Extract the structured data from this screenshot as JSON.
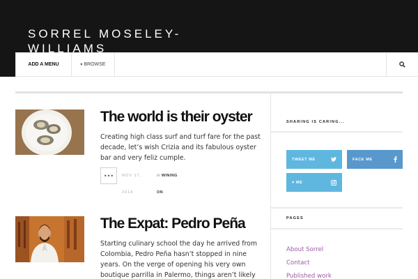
{
  "header": {
    "site_title": "SORREL MOSELEY-WILLIAMS"
  },
  "nav": {
    "add_menu": "ADD A MENU",
    "browse": "BROWSE",
    "search_icon": "search-icon"
  },
  "posts": [
    {
      "title": "The world is their oyster",
      "excerpt": "Creating high class surf and turf fare for the past decade, let’s wish Crizia and its fabulous oyster bar and very feliz cumple.",
      "date_line1": "NOV 17,",
      "date_line2": "2014",
      "meta_in": "In",
      "category_line1": "WINING",
      "category_line2": "ON",
      "more_label": "•••"
    },
    {
      "title": "The Expat: Pedro Peña",
      "excerpt": "Starting culinary school the day he arrived from Colombia, Pedro Peña hasn’t stopped in nine years. On the verge of opening his very own boutique parrilla in Palermo, things aren’t likely"
    }
  ],
  "sidebar": {
    "sharing_title": "SHARING IS CARING...",
    "share_buttons": [
      {
        "label": "TWEET ME",
        "icon": "twitter-icon",
        "color": "#5fb7e0"
      },
      {
        "label": "FACE ME",
        "icon": "facebook-icon",
        "color": "#5898cc"
      },
      {
        "label": "♥ ME",
        "icon": "instagram-icon",
        "color": "#5fb7e0"
      }
    ],
    "pages_title": "PAGES",
    "pages": [
      "About Sorrel",
      "Contact",
      "Published work"
    ]
  },
  "colors": {
    "header_bg": "#151515",
    "link": "#a05aa7",
    "twitter": "#5fb7e0",
    "facebook": "#5898cc"
  }
}
